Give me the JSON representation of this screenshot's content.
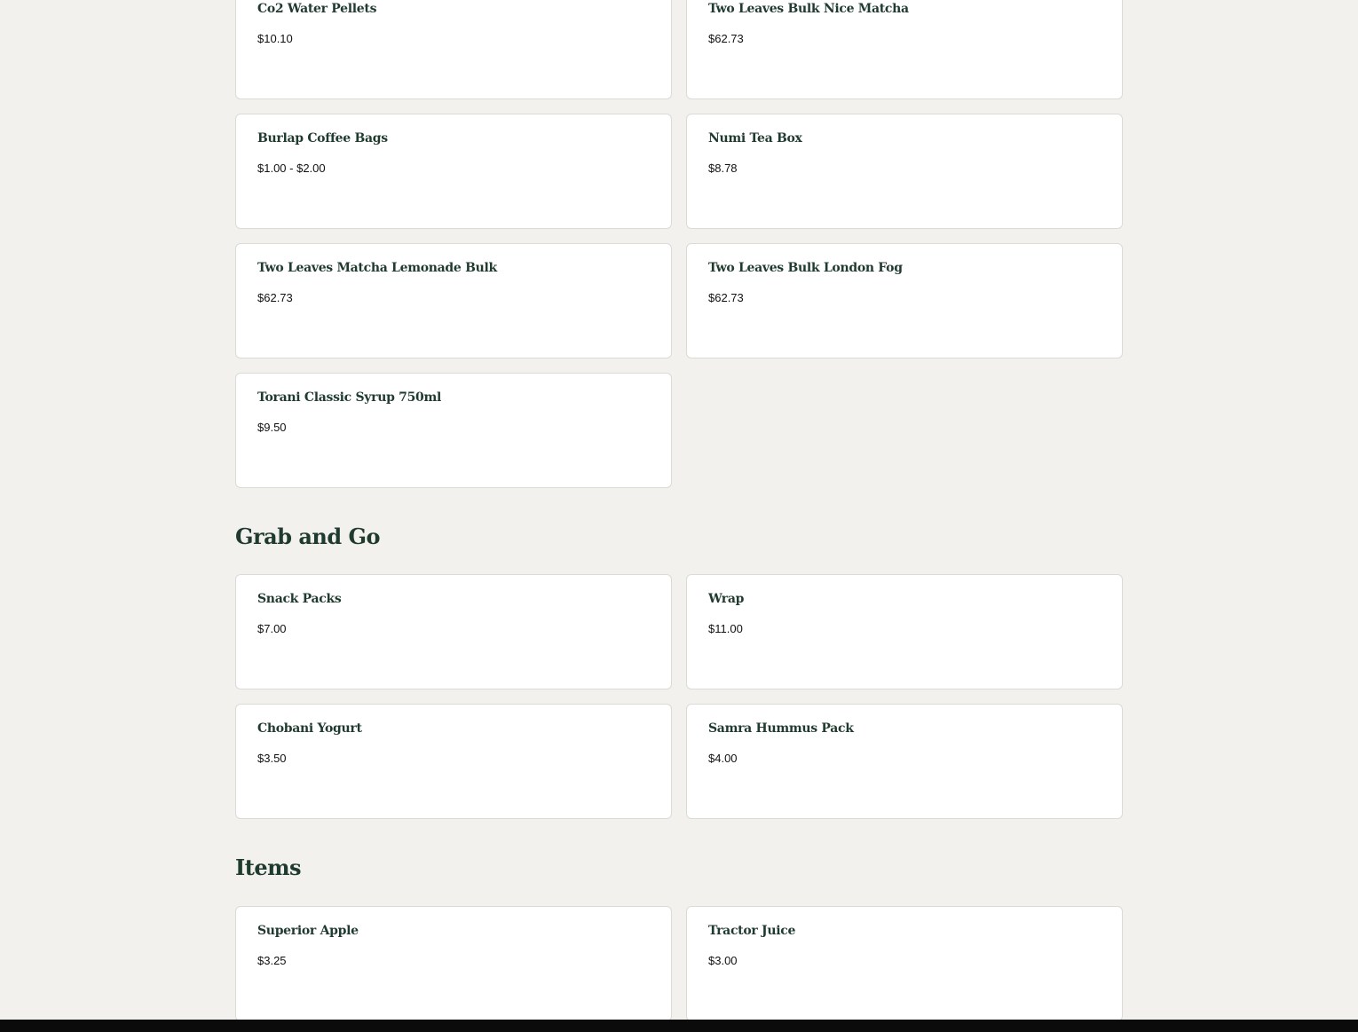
{
  "sections": [
    {
      "title": "",
      "items": [
        {
          "name": "Co2 Water Pellets",
          "price": "$10.10"
        },
        {
          "name": "Two Leaves Bulk Nice Matcha",
          "price": "$62.73"
        },
        {
          "name": "Burlap Coffee Bags",
          "price": "$1.00 - $2.00"
        },
        {
          "name": "Numi Tea Box",
          "price": "$8.78"
        },
        {
          "name": "Two Leaves Matcha Lemonade Bulk",
          "price": "$62.73"
        },
        {
          "name": "Two Leaves Bulk London Fog",
          "price": "$62.73"
        },
        {
          "name": "Torani Classic Syrup 750ml",
          "price": "$9.50"
        }
      ]
    },
    {
      "title": "Grab and Go",
      "items": [
        {
          "name": "Snack Packs",
          "price": "$7.00"
        },
        {
          "name": "Wrap",
          "price": "$11.00"
        },
        {
          "name": "Chobani Yogurt",
          "price": "$3.50"
        },
        {
          "name": "Samra Hummus Pack",
          "price": "$4.00"
        }
      ]
    },
    {
      "title": "Items",
      "items": [
        {
          "name": "Superior Apple",
          "price": "$3.25"
        },
        {
          "name": "Tractor Juice",
          "price": "$3.00"
        }
      ]
    }
  ]
}
